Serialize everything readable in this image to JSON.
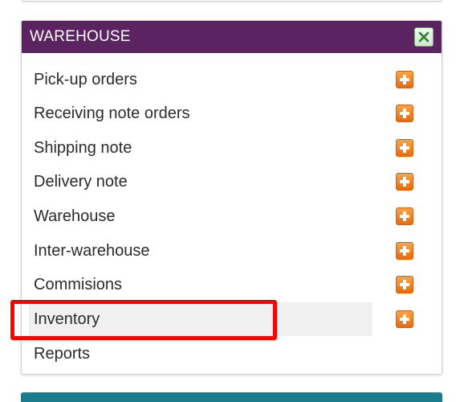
{
  "panel": {
    "title": "WAREHOUSE",
    "close_icon": "close-icon",
    "header_color": "#5b2361"
  },
  "menu": {
    "items": [
      {
        "label": "Pick-up orders",
        "has_add": true,
        "highlighted": false
      },
      {
        "label": "Receiving note orders",
        "has_add": true,
        "highlighted": false
      },
      {
        "label": "Shipping note",
        "has_add": true,
        "highlighted": false
      },
      {
        "label": "Delivery note",
        "has_add": true,
        "highlighted": false
      },
      {
        "label": "Warehouse",
        "has_add": true,
        "highlighted": false
      },
      {
        "label": "Inter-warehouse",
        "has_add": true,
        "highlighted": false
      },
      {
        "label": "Commisions",
        "has_add": true,
        "highlighted": false
      },
      {
        "label": "Inventory",
        "has_add": true,
        "highlighted": true
      },
      {
        "label": "Reports",
        "has_add": false,
        "highlighted": false
      }
    ],
    "add_icon": "plus-icon",
    "annotation_color": "#ff0000"
  },
  "colors": {
    "accent": "#5b2361",
    "add_icon": "#f08a24",
    "next_panel": "#1b7d8c"
  }
}
